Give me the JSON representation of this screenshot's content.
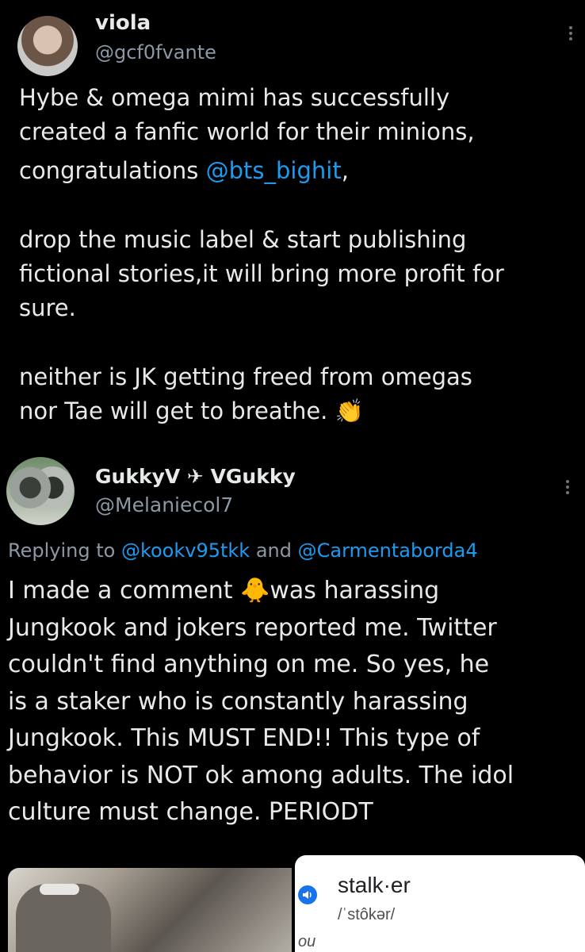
{
  "tweet1": {
    "name": "viola",
    "handle": "@gcf0fvante",
    "lines": {
      "l1": "Hybe & omega mimi has successfully",
      "l2": "created a fanfic world for their minions,",
      "l3_pre": "congratulations ",
      "l3_mention": "@bts_bighit",
      "l3_post": ",",
      "l4": "drop the music label & start publishing",
      "l5": "fictional stories,it will bring more profit for",
      "l6": "sure.",
      "l7": "neither is JK getting freed from omegas",
      "l8_text": "nor Tae will get to breathe. ",
      "l8_emoji": "👏"
    },
    "more_icon": "more-vertical-icon"
  },
  "tweet2": {
    "name": "GukkyV ✈ VGukky",
    "handle": "@Melaniecol7",
    "replying_prefix": "Replying to ",
    "replying_user1": "@kookv95tkk",
    "replying_and": " and ",
    "replying_user2": "@Carmentaborda4",
    "lines": {
      "l1_pre": "I made a comment ",
      "l1_emoji": "🐥",
      "l1_post": "was harassing",
      "l2": "Jungkook and jokers reported me. Twitter",
      "l3": "couldn't find anything on me. So yes, he",
      "l4": "is a staker who is constantly harassing",
      "l5": "Jungkook. This MUST END!! This type of",
      "l6": "behavior is NOT ok among adults. The idol",
      "l7": "culture must change. PERIODT"
    },
    "more_icon": "more-vertical-icon"
  },
  "attachment": {
    "dict_word": "stalk·er",
    "dict_pron": "/ˈstôkər/",
    "dict_cut": "ou",
    "speaker_icon": "speaker-icon"
  },
  "colors": {
    "background": "#000000",
    "text": "#e7e9ea",
    "secondary": "#8b98a5",
    "link": "#1d9bf0"
  }
}
